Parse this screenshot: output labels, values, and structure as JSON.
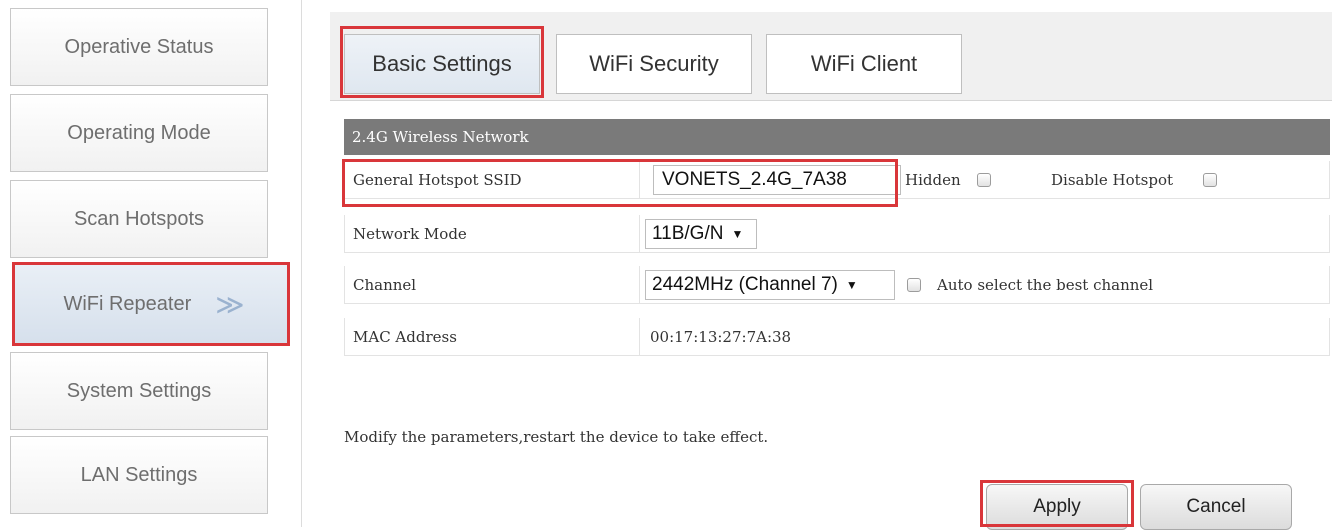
{
  "sidebar": {
    "items": [
      {
        "label": "Operative Status"
      },
      {
        "label": "Operating Mode"
      },
      {
        "label": "Scan Hotspots"
      },
      {
        "label": "WiFi Repeater",
        "chevron": "≫"
      },
      {
        "label": "System Settings"
      },
      {
        "label": "LAN Settings"
      }
    ]
  },
  "tabs": [
    {
      "label": "Basic Settings"
    },
    {
      "label": "WiFi Security"
    },
    {
      "label": "WiFi Client"
    }
  ],
  "section": {
    "title": "2.4G Wireless Network",
    "ssid_label": "General Hotspot SSID",
    "ssid_value": "VONETS_2.4G_7A38",
    "hidden_label": "Hidden",
    "disable_label": "Disable Hotspot",
    "mode_label": "Network Mode",
    "mode_value": "11B/G/N",
    "channel_label": "Channel",
    "channel_value": "2442MHz (Channel 7)",
    "auto_label": "Auto select the best channel",
    "mac_label": "MAC Address",
    "mac_value": "00:17:13:27:7A:38"
  },
  "note": "Modify the parameters,restart the device to take effect.",
  "buttons": {
    "apply": "Apply",
    "cancel": "Cancel"
  },
  "colors": {
    "highlight": "#d9363a",
    "section_header": "#7a7a7a"
  }
}
